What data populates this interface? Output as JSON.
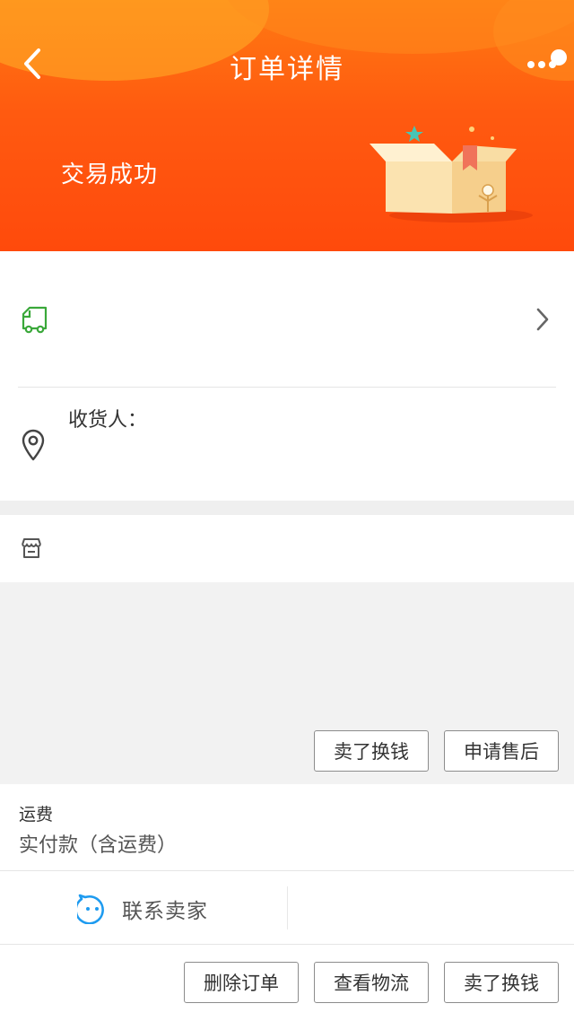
{
  "header": {
    "title": "订单详情",
    "status": "交易成功",
    "colors": {
      "gradient_top": "#ff7a12",
      "gradient_bottom": "#ff4a0c"
    },
    "icons": {
      "back": "chevron-left-icon",
      "more": "more-dots-icon"
    }
  },
  "logistics": {
    "icon": "truck-icon",
    "icon_color": "#3aa83a",
    "arrow": "chevron-right-icon"
  },
  "address": {
    "icon": "location-pin-icon",
    "receiver_label": "收货人："
  },
  "shop": {
    "icon": "shop-icon"
  },
  "goods_actions": {
    "sell_button": "卖了换钱",
    "after_sale_button": "申请售后"
  },
  "fees": {
    "freight_label": "运费",
    "paid_label": "实付款（含运费）"
  },
  "contact": {
    "icon": "chat-bubble-icon",
    "icon_color": "#1e9bf0",
    "label": "联系卖家"
  },
  "bottom_bar": {
    "delete_button": "删除订单",
    "logistics_button": "查看物流",
    "sell_button": "卖了换钱"
  }
}
